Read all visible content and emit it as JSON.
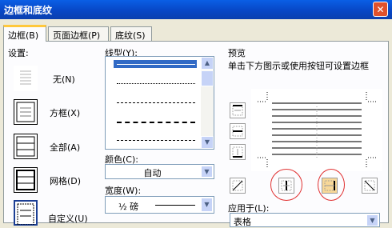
{
  "window": {
    "title": "边框和底纹",
    "close_glyph": "✕"
  },
  "tabs": [
    {
      "label": "边框(B)",
      "active": true
    },
    {
      "label": "页面边框(P)",
      "active": false
    },
    {
      "label": "底纹(S)",
      "active": false
    }
  ],
  "settings": {
    "heading": "设置:",
    "items": [
      {
        "label": "无(N)"
      },
      {
        "label": "方框(X)"
      },
      {
        "label": "全部(A)"
      },
      {
        "label": "网格(D)"
      },
      {
        "label": "自定义(U)"
      }
    ]
  },
  "line_style": {
    "label": "线型(Y):"
  },
  "color": {
    "label": "颜色(C):",
    "value": "自动"
  },
  "width": {
    "label": "宽度(W):",
    "value": "½ 磅"
  },
  "preview": {
    "heading": "预览",
    "instruction": "单击下方图示或使用按钮可设置边框"
  },
  "apply_to": {
    "label": "应用于(L):",
    "value": "表格"
  },
  "colors": {
    "title_bar": "#0a52d6",
    "highlight_circle": "#e03030",
    "tab_accent": "#ffc83c"
  }
}
